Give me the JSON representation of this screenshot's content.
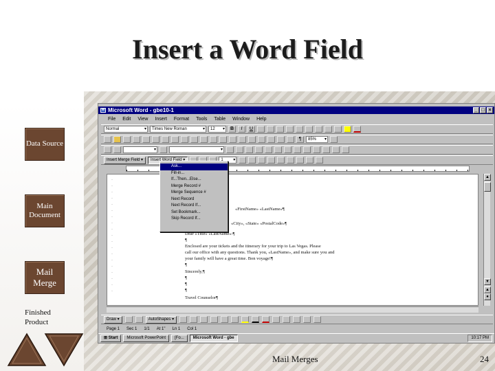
{
  "slide": {
    "title": "Insert a Word Field",
    "footer": "Mail Merges",
    "page_number": "24"
  },
  "nav": {
    "data_source": "Data Source",
    "main_document": "Main Document",
    "mail_merge": "Mail Merge",
    "finished_product": "Finished Product"
  },
  "word": {
    "title": "Microsoft Word - gbe10-1",
    "menus": [
      "File",
      "Edit",
      "View",
      "Insert",
      "Format",
      "Tools",
      "Table",
      "Window",
      "Help"
    ],
    "style": "Normal",
    "font": "Times New Roman",
    "size": "12",
    "zoom": "85%",
    "insert_merge_field": "Insert Merge Field",
    "insert_word_field": "Insert Word Field",
    "merge_record": "1",
    "word_field_menu": [
      "Ask...",
      "Fill-in...",
      "If...Then...Else...",
      "Merge Record #",
      "Merge Sequence #",
      "Next Record",
      "Next Record If...",
      "Set Bookmark...",
      "Skip Record If..."
    ],
    "doc_lines": [
      "«FirstName» «LastName»¶",
      "«City», «State» «PostalCode»¶",
      "Dear «Title» «LastName»:¶",
      "¶",
      "Enclosed are your tickets and the itinerary for your trip to Las Vegas. Please",
      "call our office with any questions. Thank you, «LastName», and make sure you and",
      "your family will have a great time. Bon voyage!¶",
      "¶",
      "Sincerely,¶",
      "¶",
      "¶",
      "¶",
      "Travel Counselor¶"
    ],
    "drawbar": {
      "draw": "Draw",
      "autoshapes": "AutoShapes"
    },
    "status": {
      "page": "Page 1",
      "section": "Sec 1",
      "pages": "1/1",
      "at": "At 1\"",
      "ln": "Ln 1",
      "col": "Col 1"
    },
    "taskbar": {
      "start": "Start",
      "powerpoint": "Microsoft PowerPoint",
      "other": "[Fo...",
      "word": "Microsoft Word - gbe",
      "clock": "10:17 PM"
    }
  },
  "colors": {
    "nav_box": "#6b4630",
    "title_bar": "#000080",
    "window": "#c0c0c0"
  }
}
